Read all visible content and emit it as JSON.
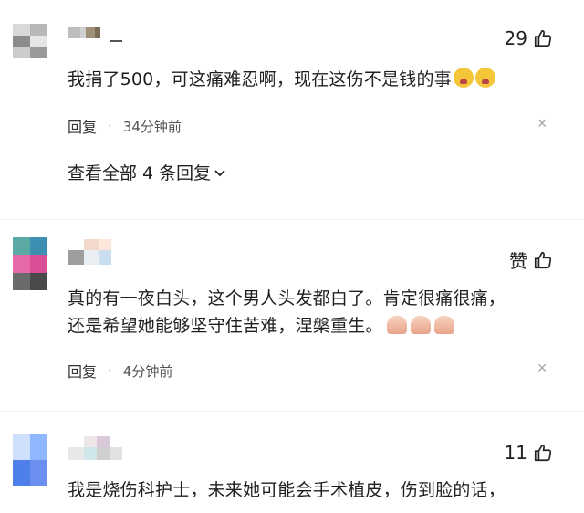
{
  "comments": [
    {
      "like_label": "29",
      "text": "我捐了500，可这痛难忍啊，现在这伤不是钱的事",
      "reply_label": "回复",
      "time": "34分钟前",
      "more_replies": "查看全部 4 条回复",
      "avatar_colors": [
        "#d9d9d9",
        "#b8b8b8",
        "#8c8c8c",
        "#e6e6e6",
        "#cccccc",
        "#9a9a9a"
      ],
      "name_colors": [
        "#bdbdbd",
        "#cfcfcf",
        "#9f8f78",
        "#7a6c55"
      ]
    },
    {
      "like_label": "赞",
      "text_lines": [
        "真的有一夜白头，这个男人头发都白了。肯定很痛很痛，",
        "还是希望她能够坚守住苦难，涅槃重生。"
      ],
      "reply_label": "回复",
      "time": "4分钟前",
      "avatar_colors": [
        "#5aa9a3",
        "#3d8fb1",
        "#e76aa8",
        "#d94f96",
        "#6b6b6b",
        "#4a4a4a"
      ],
      "name_colors": [
        "#f2d9cc",
        "#ffe6dd",
        "#9e9e9e",
        "#c9dff0"
      ]
    },
    {
      "like_label": "11",
      "text": "我是烧伤科护士，未来她可能会手术植皮，伤到脸的话，",
      "avatar_colors": [
        "#cfe0ff",
        "#8fb7ff",
        "#4f7fe8",
        "#6a8ff0"
      ],
      "name_colors": [
        "#efe6e6",
        "#d9c9d9",
        "#cfe6ea",
        "#d0d0d0",
        "#e8e8e8"
      ]
    }
  ],
  "icons": {
    "like": "thumbs-up-icon",
    "close": "close-icon",
    "chevron": "chevron-down-icon"
  }
}
